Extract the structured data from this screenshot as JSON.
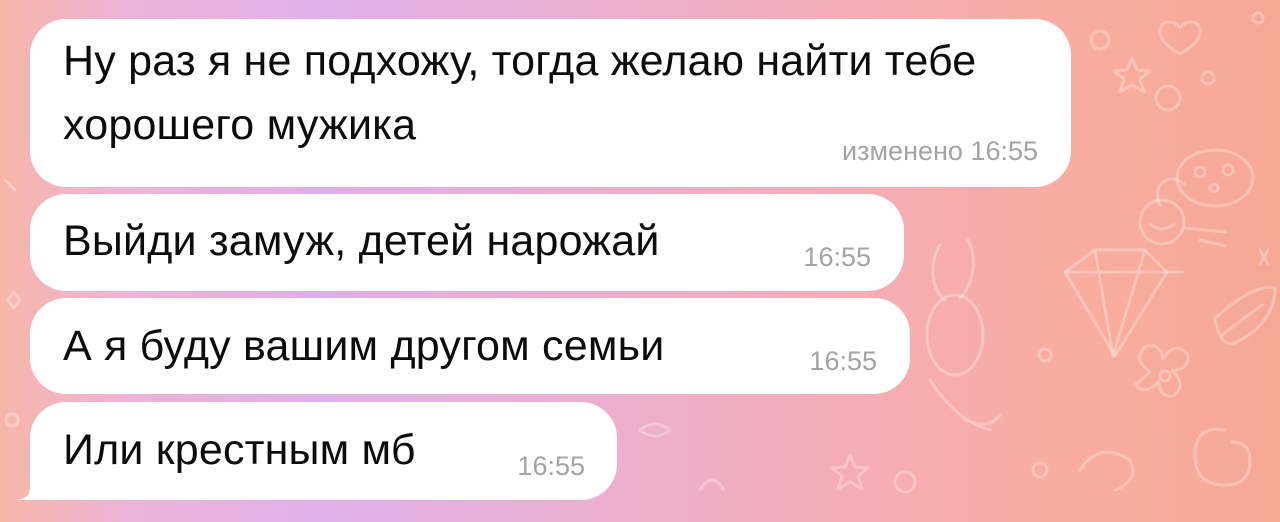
{
  "messages": [
    {
      "text": "Ну раз я не подхожу, тогда желаю найти тебе хорошего мужика",
      "time": "изменено 16:55"
    },
    {
      "text": "Выйди замуж, детей нарожай",
      "time": "16:55"
    },
    {
      "text": "А я буду вашим другом семьи",
      "time": "16:55"
    },
    {
      "text": "Или крестным мб",
      "time": "16:55"
    }
  ],
  "colors": {
    "bubble": "#ffffff",
    "text": "#0c0c0c",
    "time": "#a3a3a3"
  }
}
